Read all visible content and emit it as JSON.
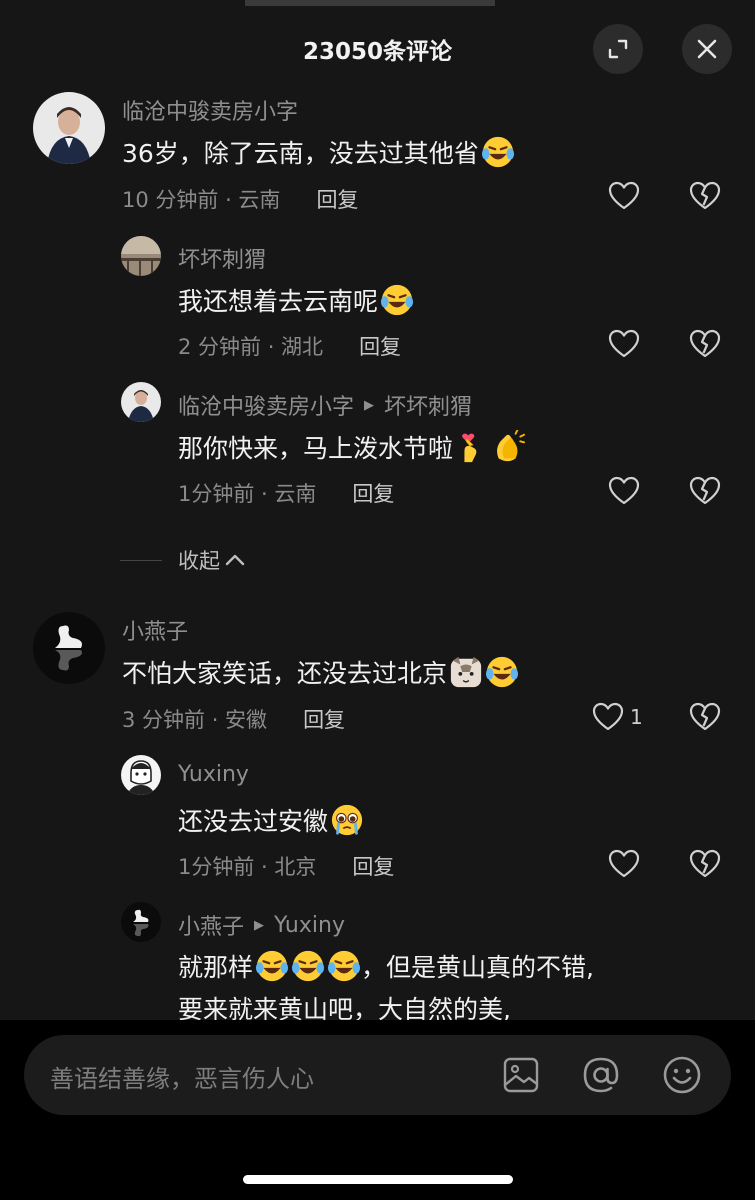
{
  "header": {
    "title": "23050条评论"
  },
  "comments": [
    {
      "user": "临沧中骏卖房小字",
      "text": "36岁，除了云南，没去过其他省",
      "time": "10 分钟前 · 云南",
      "reply_label": "回复",
      "emoji": [
        "laughing-crying-emoji"
      ],
      "replies": [
        {
          "user": "坏坏刺猬",
          "text": "我还想着去云南呢",
          "time": "2 分钟前 · 湖北",
          "reply_label": "回复",
          "emoji": [
            "laughing-crying-emoji"
          ]
        },
        {
          "user": "临沧中骏卖房小字",
          "reply_to": "坏坏刺猬",
          "text": "那你快来，马上泼水节啦",
          "time": "1分钟前 · 云南",
          "reply_label": "回复",
          "emoji": [
            "finger-heart-emoji",
            "clapping-hands-emoji"
          ]
        }
      ],
      "collapse_label": "收起"
    },
    {
      "user": "小燕子",
      "text": "不怕大家笑话，还没去过北京",
      "time": "3 分钟前 · 安徽",
      "reply_label": "回复",
      "like_count": "1",
      "emoji": [
        "cat-face-emoji",
        "laughing-crying-emoji"
      ],
      "replies": [
        {
          "user": "Yuxiny",
          "text": "还没去过安徽",
          "time": "1分钟前 · 北京",
          "reply_label": "回复",
          "emoji": [
            "pleading-tears-emoji"
          ]
        },
        {
          "user": "小燕子",
          "reply_to": "Yuxiny",
          "text_line1_a": "就那样",
          "text_line1_b": "，但是黄山真的不错,",
          "text_line2": "要来就来黄山吧，大自然的美,",
          "emoji": [
            "laughing-crying-emoji",
            "laughing-crying-emoji",
            "laughing-crying-emoji"
          ]
        }
      ]
    }
  ],
  "input": {
    "placeholder": "善语结善缘，恶言伤人心"
  },
  "icons": [
    "expand-icon",
    "close-icon",
    "heart-icon",
    "broken-heart-icon",
    "chevron-up-icon",
    "image-icon",
    "at-icon",
    "smiley-icon"
  ],
  "colors": {
    "background": "#161616",
    "text": "#f1f1f1",
    "muted": "#8f8f8f",
    "input_bar": "#1c1c1c"
  }
}
